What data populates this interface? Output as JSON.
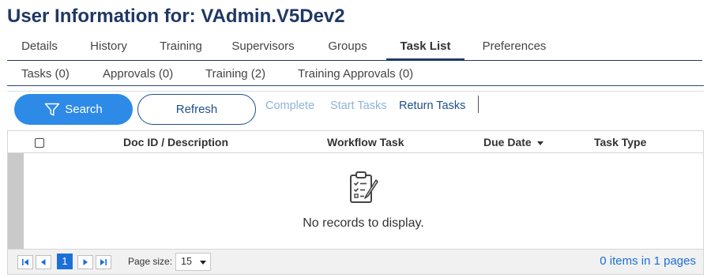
{
  "page": {
    "title": "User Information for: VAdmin.V5Dev2"
  },
  "main_tabs": [
    {
      "label": "Details"
    },
    {
      "label": "History"
    },
    {
      "label": "Training"
    },
    {
      "label": "Supervisors"
    },
    {
      "label": "Groups"
    },
    {
      "label": "Task List",
      "active": true
    },
    {
      "label": "Preferences"
    }
  ],
  "sub_tabs": [
    {
      "label": "Tasks (0)"
    },
    {
      "label": "Approvals (0)"
    },
    {
      "label": "Training (2)"
    },
    {
      "label": "Training Approvals (0)"
    }
  ],
  "toolbar": {
    "search_label": "Search",
    "refresh_label": "Refresh",
    "complete_label": "Complete",
    "start_tasks_label": "Start Tasks",
    "return_tasks_label": "Return Tasks"
  },
  "grid": {
    "columns": [
      "Doc ID / Description",
      "Workflow Task",
      "Due Date",
      "Task Type"
    ],
    "empty_message": "No records to display."
  },
  "pager": {
    "current_page": "1",
    "page_size_label": "Page size:",
    "page_size": "15",
    "info": "0 items in 1 pages"
  },
  "colors": {
    "title": "#1f3864",
    "primary_button": "#2d8ae6",
    "link": "#1f4e8c",
    "disabled_link": "#8fb3d9",
    "pager_active": "#1d6fd8"
  },
  "icons": {
    "search": "filter-icon",
    "empty": "clipboard-checklist-icon",
    "pager_first": "first-page-icon",
    "pager_prev": "prev-page-icon",
    "pager_next": "next-page-icon",
    "pager_last": "last-page-icon"
  }
}
